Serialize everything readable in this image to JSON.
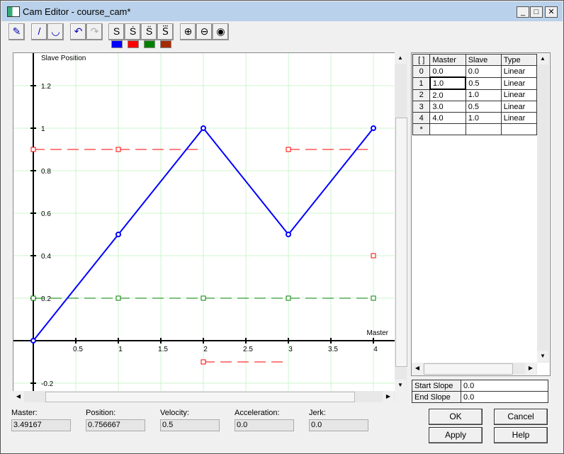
{
  "window": {
    "title": "Cam Editor - course_cam*",
    "minimize": "_",
    "maximize": "□",
    "close": "✕"
  },
  "toolbar": {
    "buttons": [
      {
        "name": "edit-point-icon",
        "glyph": "✎"
      },
      {
        "name": "line-icon",
        "glyph": "/"
      },
      {
        "name": "curve-icon",
        "glyph": "◡"
      },
      {
        "name": "undo-icon",
        "glyph": "↶"
      },
      {
        "name": "redo-icon",
        "glyph": "↷"
      },
      {
        "name": "position-s",
        "glyph": "S"
      },
      {
        "name": "velocity-s",
        "glyph": "Ṡ"
      },
      {
        "name": "acceleration-s",
        "glyph": "S̈"
      },
      {
        "name": "jerk-s",
        "glyph": "S⃛"
      },
      {
        "name": "zoom-in-icon",
        "glyph": "⊕"
      },
      {
        "name": "zoom-out-icon",
        "glyph": "⊖"
      },
      {
        "name": "zoom-fit-icon",
        "glyph": "◉"
      }
    ],
    "swatches": [
      "#0000ff",
      "#ff0000",
      "#008000",
      "#a52a00"
    ]
  },
  "chart_data": {
    "type": "line",
    "ylabel": "Slave Position",
    "xlabel": "Master",
    "xlim": [
      -0.2,
      4.2
    ],
    "ylim": [
      -0.25,
      1.35
    ],
    "xticks": [
      "0.5",
      "1",
      "1.5",
      "2",
      "2.5",
      "3",
      "3.5",
      "4"
    ],
    "yticks": [
      "1.2",
      "1",
      "0.8",
      "0.6",
      "0.4",
      "0.2",
      "-0.2"
    ],
    "grid": true,
    "series": [
      {
        "kind": "position",
        "color": "#0000ff",
        "x": [
          0,
          1,
          2,
          3,
          4
        ],
        "y": [
          0,
          0.5,
          1,
          0.5,
          1
        ]
      },
      {
        "kind": "velocity",
        "color": "#ff0000",
        "segments": [
          [
            0,
            2,
            0.9
          ],
          [
            2,
            3,
            -0.1
          ],
          [
            3,
            4,
            0.9
          ]
        ],
        "markers": [
          [
            0,
            0.9
          ],
          [
            1,
            0.9
          ],
          [
            2,
            -0.1
          ],
          [
            3,
            0.9
          ],
          [
            4,
            0.4
          ]
        ]
      },
      {
        "kind": "acceleration",
        "color": "#008000",
        "segments": [
          [
            0,
            4,
            0.2
          ]
        ],
        "markers": [
          [
            0,
            0.2
          ],
          [
            1,
            0.2
          ],
          [
            2,
            0.2
          ],
          [
            3,
            0.2
          ],
          [
            4,
            0.2
          ]
        ]
      },
      {
        "kind": "jerk",
        "color": "#a52a00",
        "segments": [
          [
            0,
            4,
            0.2
          ]
        ],
        "markers": [
          [
            0,
            0.2
          ],
          [
            1,
            0.2
          ],
          [
            2,
            0.2
          ],
          [
            3,
            0.2
          ],
          [
            4,
            0.2
          ]
        ]
      }
    ]
  },
  "table": {
    "headers": [
      "[ ]",
      "Master",
      "Slave",
      "Type"
    ],
    "rows": [
      [
        "0",
        "0.0",
        "0.0",
        "Linear"
      ],
      [
        "1",
        "1.0",
        "0.5",
        "Linear"
      ],
      [
        "2",
        "2.0",
        "1.0",
        "Linear"
      ],
      [
        "3",
        "3.0",
        "0.5",
        "Linear"
      ],
      [
        "4",
        "4.0",
        "1.0",
        "Linear"
      ],
      [
        "*",
        "",
        "",
        ""
      ]
    ]
  },
  "slopes": {
    "start_label": "Start Slope",
    "start_value": "0.0",
    "end_label": "End Slope",
    "end_value": "0.0"
  },
  "readouts": [
    {
      "label": "Master:",
      "value": "3.49167"
    },
    {
      "label": "Position:",
      "value": "0.756667"
    },
    {
      "label": "Velocity:",
      "value": "0.5"
    },
    {
      "label": "Acceleration:",
      "value": "0.0"
    },
    {
      "label": "Jerk:",
      "value": "0.0"
    }
  ],
  "buttons": {
    "ok": "OK",
    "cancel": "Cancel",
    "apply": "Apply",
    "help": "Help"
  }
}
